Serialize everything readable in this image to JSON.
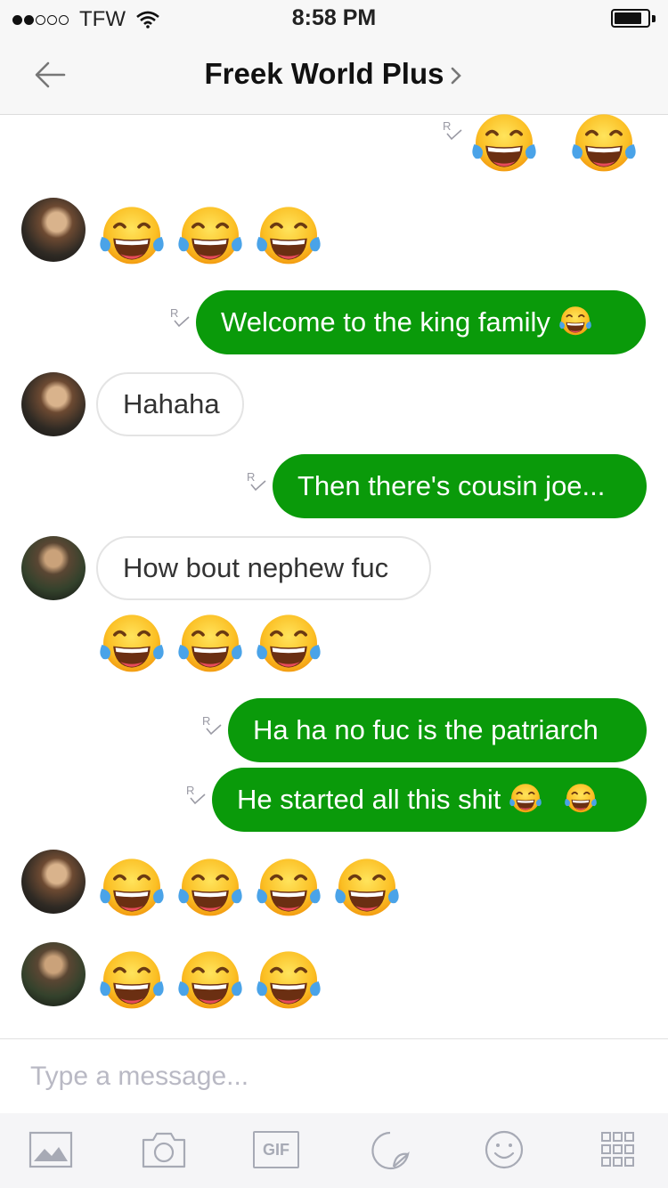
{
  "status_bar": {
    "carrier": "TFW",
    "time": "8:58 PM"
  },
  "header": {
    "title": "Freek World Plus"
  },
  "messages": [
    {
      "text": "Welcome to the king family"
    },
    {
      "text": "Hahaha"
    },
    {
      "text": "Then there's cousin joe..."
    },
    {
      "text": "How bout nephew fuc"
    },
    {
      "text": "Ha ha no fuc is the patriarch"
    },
    {
      "text": "He started all this shit"
    }
  ],
  "composer": {
    "placeholder": "Type a message..."
  },
  "toolbar": {
    "gif_label": "GIF"
  },
  "icons": [
    "back-arrow-icon",
    "chevron-right-icon",
    "read-receipt-icon",
    "photo-icon",
    "camera-icon",
    "gif-icon",
    "sticker-icon",
    "smiley-icon",
    "grid-icon"
  ],
  "colors": {
    "outgoing_bubble": "#0a9a0a",
    "header_bg": "#f7f7f7",
    "placeholder": "#b9b9c4"
  }
}
